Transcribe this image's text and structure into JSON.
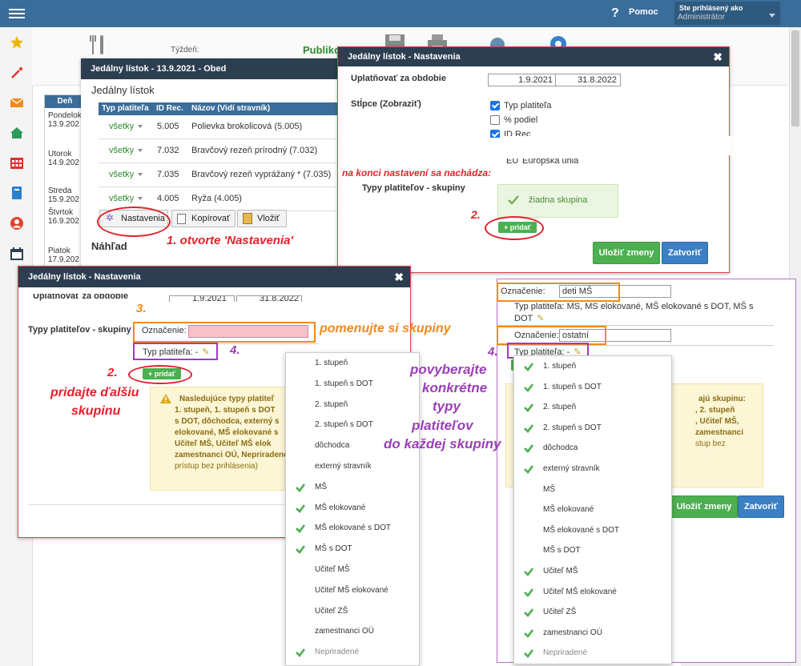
{
  "header": {
    "help_label": "Pomoc",
    "user_line1": "Ste prihlásený ako",
    "user_line2": "Administrátor"
  },
  "background": {
    "week_label": "Týždeň:",
    "publish_label": "Publiko",
    "days_header": "Deň",
    "days": [
      {
        "name": "Pondelok",
        "date": "13.9.202"
      },
      {
        "name": "Utorok",
        "date": "14.9.202"
      },
      {
        "name": "Streda",
        "date": "15.9.202"
      },
      {
        "name": "Štvrtok",
        "date": "16.9.202"
      },
      {
        "name": "Piatok",
        "date": "17.9.202"
      }
    ]
  },
  "menu_dialog": {
    "title": "Jedálny lístok - 13.9.2021 - Obed",
    "section_title": "Jedálny lístok",
    "columns": [
      "Typ platiteľa",
      "ID Rec.",
      "Názov (Vidí stravník)"
    ],
    "rows": [
      {
        "type": "všetky",
        "id": "5.005",
        "name": "Polievka brokolicová (5.005)"
      },
      {
        "type": "všetky",
        "id": "7.032",
        "name": "Bravčový rezeň prírodný (7.032)"
      },
      {
        "type": "všetky",
        "id": "7.035",
        "name": "Bravčový rezeň vyprážaný * (7.035)"
      },
      {
        "type": "všetky",
        "id": "4.005",
        "name": "Ryža (4.005)"
      }
    ],
    "buttons": {
      "settings": "Nastavenia",
      "copy": "Kopírovať",
      "paste": "Vložiť"
    },
    "preview_title": "Náhľad"
  },
  "settings_dialog_a": {
    "title": "Jedálny lístok - Nastavenia",
    "period_label": "Uplatňovať za obdobie",
    "date_from": "1.9.2021",
    "date_to": "31.8.2022",
    "columns_label": "Stĺpce (Zobraziť)",
    "columns": [
      {
        "label": "Typ platiteľa",
        "checked": true
      },
      {
        "label": "% podiel",
        "checked": false
      },
      {
        "label": "ID Rec",
        "checked": true
      }
    ],
    "partial_text": "Európska únia",
    "partial_code": "EU",
    "groups_label": "Typy platiteľov - skupiny",
    "no_group_text": "žiadna skupina",
    "add_label": "+ pridať",
    "save_label": "Uložiť zmeny",
    "close_label": "Zatvoriť"
  },
  "settings_dialog_b": {
    "title": "Jedálny lístok - Nastavenia",
    "period_label": "Uplatňovať za obdobie",
    "date_from": "1.9.2021",
    "date_to": "31.8.2022",
    "groups_label": "Typy platiteľov - skupiny",
    "name_label": "Označenie:",
    "payer_type_label": "Typ platiteľa: -",
    "add_label": "+ pridať",
    "warning_lines": [
      "Nasledujúce typy platiteľ",
      "1. stupeň, 1. stupeň s DOT",
      "s DOT, dôchodca, externý s",
      "elokované, MŠ elokované s",
      "Učiteľ MŠ, Učiteľ MŠ elok",
      "zamestnanci OÚ, Nepriradené",
      "prístup bez prihlásenia)"
    ]
  },
  "dropdown_left": {
    "items": [
      {
        "label": "1. stupeň",
        "checked": false
      },
      {
        "label": "1. stupeň s DOT",
        "checked": false
      },
      {
        "label": "2. stupeň",
        "checked": false
      },
      {
        "label": "2. stupeň s DOT",
        "checked": false
      },
      {
        "label": "dôchodca",
        "checked": false
      },
      {
        "label": "externý stravník",
        "checked": false
      },
      {
        "label": "MŠ",
        "checked": true
      },
      {
        "label": "MŠ elokované",
        "checked": true
      },
      {
        "label": "MŠ elokované s DOT",
        "checked": true
      },
      {
        "label": "MŠ s DOT",
        "checked": true
      },
      {
        "label": "Učiteľ MŠ",
        "checked": false
      },
      {
        "label": "Učiteľ MŠ elokované",
        "checked": false
      },
      {
        "label": "Učiteľ ZŠ",
        "checked": false
      },
      {
        "label": "zamestnanci OÚ",
        "checked": false
      },
      {
        "label": "Nepriradené",
        "checked": true
      }
    ]
  },
  "right_panel": {
    "name_label": "Označenie:",
    "group1_value": "deti MŠ",
    "group1_types_line1": "Typ platiteľa: MS, MS elokované, MŠ elokované s DOT, MŠ s",
    "group1_types_line2": "DOT",
    "group2_value": "ostatní",
    "payer_type_label": "Typ platiteľa: -",
    "warning_lines": [
      "ajú skupinu:",
      ", 2. stupeň",
      ", Učiteľ MŠ,",
      "zamestnanci",
      "stup bez"
    ],
    "save_label": "Uložiť zmeny",
    "close_label": "Zatvoriť"
  },
  "dropdown_right": {
    "items": [
      {
        "label": "1. stupeň",
        "checked": true
      },
      {
        "label": "1. stupeň s DOT",
        "checked": true
      },
      {
        "label": "2. stupeň",
        "checked": true
      },
      {
        "label": "2. stupeň s DOT",
        "checked": true
      },
      {
        "label": "dôchodca",
        "checked": true
      },
      {
        "label": "externý stravník",
        "checked": true
      },
      {
        "label": "MŠ",
        "checked": false
      },
      {
        "label": "MŠ elokované",
        "checked": false
      },
      {
        "label": "MŠ elokované s DOT",
        "checked": false
      },
      {
        "label": "MŠ s DOT",
        "checked": false
      },
      {
        "label": "Učiteľ MŠ",
        "checked": true
      },
      {
        "label": "Učiteľ MŠ elokované",
        "checked": true
      },
      {
        "label": "Učiteľ ZŠ",
        "checked": true
      },
      {
        "label": "zamestnanci OÚ",
        "checked": true
      },
      {
        "label": "Nepriradené",
        "checked": true
      }
    ]
  },
  "annotations": {
    "step1": "1.  otvorte 'Nastavenia'",
    "end_note": "na konci nastavení sa nachádza:",
    "step2_a": "2.",
    "step2_b": "2.",
    "step2_text_1": "pridajte ďalšiu",
    "step2_text_2": "skupinu",
    "step3": "3.",
    "step3_text": "pomenujte si skupiny",
    "step4_a": "4.",
    "step4_b": "4.",
    "step4_text_1": "povyberajte",
    "step4_text_2": "konkrétne",
    "step4_text_3": "typy",
    "step4_text_4": "platiteľov",
    "step4_text_5": "do každej skupiny"
  },
  "colors": {
    "topbar": "#3a6d99",
    "dialog_header": "#2c3e50",
    "annotation_red": "#e8202a",
    "annotation_orange": "#f08a1c",
    "annotation_purple": "#9b3fb6",
    "check_green": "#4caf50"
  }
}
